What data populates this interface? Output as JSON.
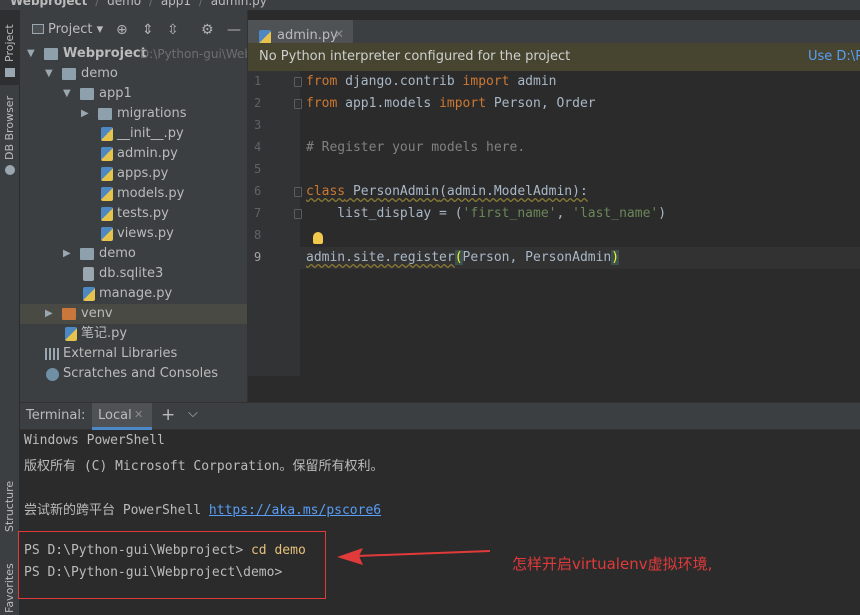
{
  "breadcrumb": {
    "items": [
      "Webproject",
      "demo",
      "app1",
      "admin.py"
    ],
    "separator": "/"
  },
  "left_strip": {
    "tabs": [
      "Project",
      "DB Browser",
      "Structure",
      "Favorites"
    ]
  },
  "project_panel": {
    "view_label": "Project",
    "tree": [
      {
        "label": "Webproject",
        "path": "D:\\Python-gui\\Web",
        "type": "folder",
        "expanded": true
      },
      {
        "label": "demo",
        "type": "folder",
        "expanded": true
      },
      {
        "label": "app1",
        "type": "folder",
        "expanded": true
      },
      {
        "label": "migrations",
        "type": "folder",
        "expanded": false
      },
      {
        "label": "__init__.py",
        "type": "py"
      },
      {
        "label": "admin.py",
        "type": "py"
      },
      {
        "label": "apps.py",
        "type": "py"
      },
      {
        "label": "models.py",
        "type": "py"
      },
      {
        "label": "tests.py",
        "type": "py"
      },
      {
        "label": "views.py",
        "type": "py"
      },
      {
        "label": "demo",
        "type": "folder",
        "expanded": false
      },
      {
        "label": "db.sqlite3",
        "type": "db"
      },
      {
        "label": "manage.py",
        "type": "py"
      },
      {
        "label": "venv",
        "type": "folder-orange",
        "expanded": false
      },
      {
        "label": "笔记.py",
        "type": "py"
      },
      {
        "label": "External Libraries",
        "type": "lib"
      },
      {
        "label": "Scratches and Consoles",
        "type": "scratch"
      }
    ]
  },
  "editor": {
    "tab_label": "admin.py",
    "banner_message": "No Python interpreter configured for the project",
    "banner_link": "Use D:\\Py",
    "line_numbers": [
      "1",
      "2",
      "3",
      "4",
      "5",
      "6",
      "7",
      "8",
      "9"
    ],
    "code": [
      {
        "a": "from",
        "b": " django.contrib ",
        "c": "import",
        "d": " admin"
      },
      {
        "a": "from",
        "b": " app1.models ",
        "c": "import",
        "d": " Person, Order"
      },
      {
        "a": "",
        "b": "",
        "c": "",
        "d": ""
      },
      {
        "comment": "# Register your models here."
      },
      {
        "a": "",
        "b": "",
        "c": "",
        "d": ""
      },
      {
        "kw": "class",
        "name": " PersonAdmin",
        "rest": "(admin.ModelAdmin):"
      },
      {
        "pre": "    list_display = (",
        "s1": "'first_name'",
        "mid": ", ",
        "s2": "'last_name'",
        "post": ")"
      },
      {
        "a": "",
        "b": "",
        "c": "",
        "d": ""
      },
      {
        "pre": "admin.site.register",
        "open": "(",
        "args": "Person, PersonAdmin",
        "close": ")"
      }
    ]
  },
  "terminal": {
    "title": "Terminal:",
    "tab_label": "Local",
    "lines": [
      "Windows PowerShell",
      "版权所有 (C) Microsoft Corporation。保留所有权利。",
      "",
      "尝试新的跨平台 PowerShell "
    ],
    "link": "https://aka.ms/pscore6",
    "prompt1": "PS D:\\Python-gui\\Webproject> ",
    "command1": "cd demo",
    "prompt2": "PS D:\\Python-gui\\Webproject\\demo>"
  },
  "annotation": {
    "text": "怎样开启virtualenv虚拟环境,",
    "color": "#e03a3a"
  },
  "colors": {
    "keyword": "#cc7832",
    "string": "#6a8759",
    "comment": "#808080",
    "link": "#589df6",
    "accent": "#4a88c7"
  }
}
